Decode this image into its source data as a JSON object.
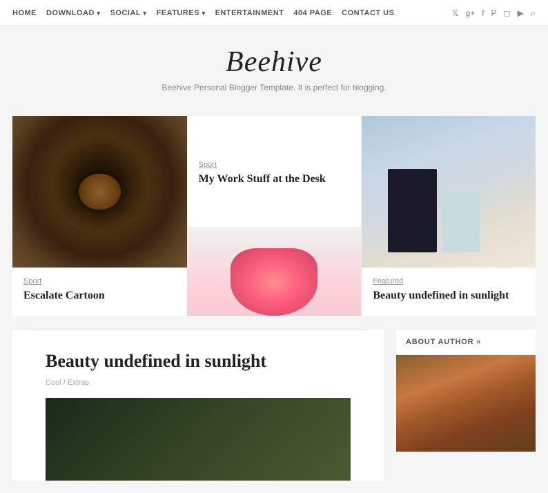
{
  "nav": {
    "items": [
      {
        "label": "HOME",
        "has_dropdown": false
      },
      {
        "label": "DOWNLOAD",
        "has_dropdown": true
      },
      {
        "label": "SOCIAL",
        "has_dropdown": true
      },
      {
        "label": "FEATURES",
        "has_dropdown": true
      },
      {
        "label": "ENTERTAINMENT",
        "has_dropdown": false
      },
      {
        "label": "404 PAGE",
        "has_dropdown": false
      },
      {
        "label": "CONTACT US",
        "has_dropdown": false
      }
    ],
    "social_icons": [
      "twitter",
      "google-plus",
      "facebook",
      "pinterest",
      "vimeo",
      "youtube",
      "search"
    ]
  },
  "header": {
    "title": "Beehive",
    "subtitle": "Beehive Personal Blogger Template. It is perfect for blogging."
  },
  "posts": {
    "left": {
      "category": "Sport",
      "title": "Escalate Cartoon"
    },
    "middle_top": {
      "category": "Sport",
      "title": "My Work Stuff at the Desk"
    },
    "right": {
      "category": "Featured",
      "title": "Beauty undefined in sunlight"
    }
  },
  "featured": {
    "title": "Beauty undefined in sunlight",
    "meta_separator": "/",
    "cat1": "Cool",
    "cat2": "Extras"
  },
  "sidebar": {
    "about_label": "ABOUT AUTHOR »"
  },
  "icons": {
    "twitter": "𝕏",
    "google_plus": "g+",
    "facebook": "f",
    "pinterest": "P",
    "vimeo": "v",
    "youtube": "▶",
    "search": "🔍",
    "dropdown_arrow": "▾"
  }
}
